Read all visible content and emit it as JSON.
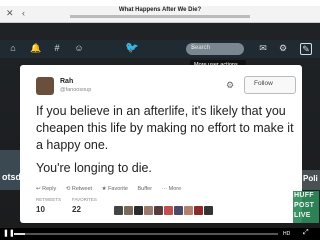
{
  "browser": {
    "page_title": "What Happens After We Die?",
    "back_icon": "close-icon",
    "forward_icon": "chevron-left-icon"
  },
  "twitter_nav": {
    "search_placeholder": "Search",
    "tooltip": "More user actions",
    "compose_icon": "feather-icon"
  },
  "tweet": {
    "name": "Rah",
    "handle": "@fanoosoup",
    "follow_label": "Follow",
    "text": "If you believe in an afterlife, it's likely that you cheapen this life by making no effort to make it a happy one.",
    "text2": "You're longing to die.",
    "actions": [
      "Reply",
      "Retweet",
      "Favorite",
      "Buffer",
      "More"
    ],
    "retweets_label": "RETWEETS",
    "retweets": "10",
    "favorites_label": "FAVORITES",
    "favorites": "22"
  },
  "background": {
    "left_text": "otsd",
    "right_text": "Poli"
  },
  "logo": {
    "line1": "HUFF",
    "line2": "POST",
    "line3": "LIVE"
  },
  "video": {
    "hd_label": "HD",
    "progress_fraction": 0.04
  },
  "colors": {
    "twitter_blue": "#55acee",
    "huffpost_green": "#2e8a5a"
  }
}
